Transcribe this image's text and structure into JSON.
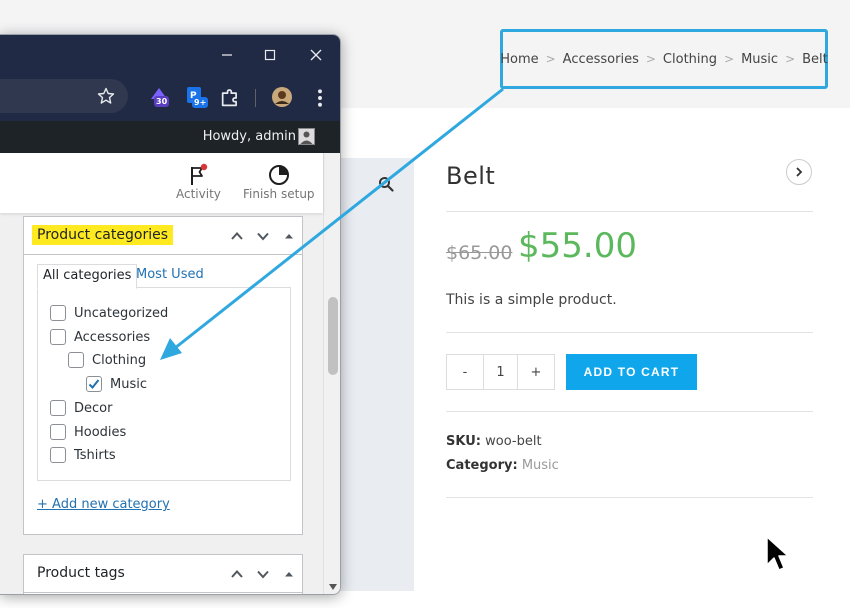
{
  "breadcrumb": [
    "Home",
    "Accessories",
    "Clothing",
    "Music",
    "Belt"
  ],
  "product": {
    "title": "Belt",
    "price_old": "$65.00",
    "price_new": "$55.00",
    "short_description": "This is a simple product.",
    "quantity": "1",
    "qty_minus": "-",
    "qty_plus": "+",
    "add_to_cart": "ADD TO CART",
    "sku_label": "SKU:",
    "sku_value": "woo-belt",
    "category_label": "Category:",
    "category_value": "Music"
  },
  "browser": {
    "extensions": [
      {
        "name": "extension-icon",
        "badge": "30",
        "badge_color": "#5a3fc0"
      },
      {
        "name": "extension-icon",
        "badge": "9+",
        "badge_color": "#1a73e8"
      }
    ]
  },
  "admin_bar": {
    "greeting": "Howdy, admin"
  },
  "wc_header": {
    "activity": "Activity",
    "finish_setup": "Finish setup"
  },
  "categories_box": {
    "title": "Product categories",
    "tab_all": "All categories",
    "tab_most_used": "Most Used",
    "items": [
      {
        "label": "Uncategorized",
        "checked": false,
        "level": 0
      },
      {
        "label": "Accessories",
        "checked": false,
        "level": 0
      },
      {
        "label": "Clothing",
        "checked": false,
        "level": 1
      },
      {
        "label": "Music",
        "checked": true,
        "level": 2
      },
      {
        "label": "Decor",
        "checked": false,
        "level": 0
      },
      {
        "label": "Hoodies",
        "checked": false,
        "level": 0
      },
      {
        "label": "Tshirts",
        "checked": false,
        "level": 0
      }
    ],
    "add_new": "+ Add new category"
  },
  "tags_box": {
    "title": "Product tags"
  },
  "colors": {
    "accent_blue": "#2fa8e0",
    "price_green": "#5cb85c",
    "button_blue": "#10a6ec",
    "highlight_yellow": "#ffe920",
    "admin_dark": "#1d2327",
    "browser_dark": "#202a44"
  }
}
